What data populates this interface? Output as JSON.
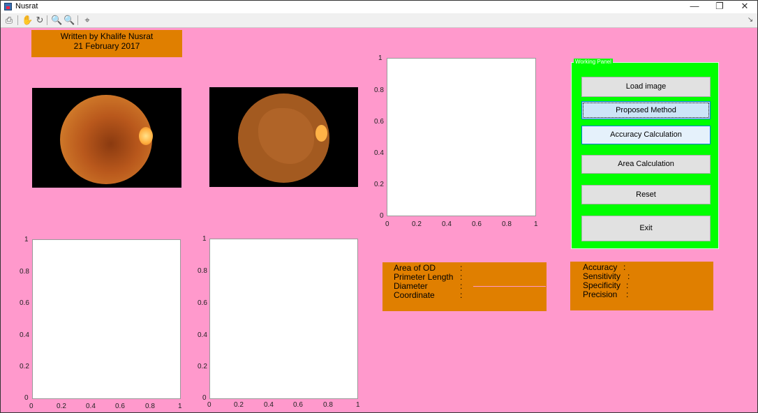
{
  "window": {
    "title": "Nusrat",
    "minimize": "—",
    "restore": "❐",
    "close": "✕"
  },
  "toolbar": {
    "icons": [
      "print-icon",
      "pan-icon",
      "rotate-icon",
      "zoom-in-icon",
      "zoom-out-icon",
      "data-cursor-icon"
    ]
  },
  "credit": {
    "line1": "Written by Khalife Nusrat",
    "line2": "21 February 2017"
  },
  "axes": {
    "y_ticks": [
      "1",
      "0.8",
      "0.6",
      "0.4",
      "0.2",
      "0"
    ],
    "x_ticks": [
      "0",
      "0.2",
      "0.4",
      "0.6",
      "0.8",
      "1"
    ]
  },
  "panel": {
    "title": "Working Panel",
    "buttons": {
      "load": "Load image",
      "proposed": "Proposed Method",
      "accuracy": "Accuracy Calculation",
      "area": "Area Calculation",
      "reset": "Reset",
      "exit": "Exit"
    }
  },
  "measures": {
    "area": "Area  of OD",
    "perimeter": "Primeter Length",
    "diameter": "Diameter",
    "coordinate": "Coordinate",
    "colon": ":"
  },
  "metrics": {
    "accuracy": "Accuracy",
    "sensitivity": "Sensitivity",
    "specificity": "Specificity",
    "precision": "Precision",
    "colon": ":"
  },
  "colors": {
    "background": "#ff99cc",
    "label_boxes": "#e07f00",
    "panel": "#00ff00"
  }
}
